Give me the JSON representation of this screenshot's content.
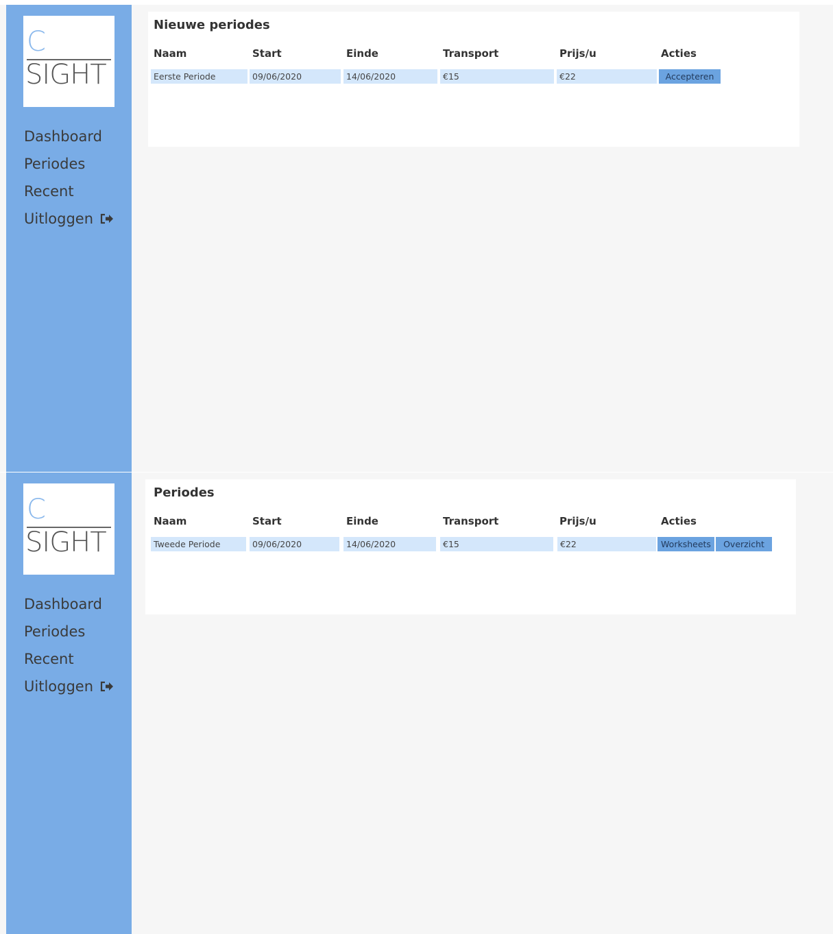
{
  "sidebar": {
    "logo": {
      "letter": "C",
      "word": "SIGHT"
    },
    "nav": [
      "Dashboard",
      "Periodes",
      "Recent",
      "Uitloggen"
    ]
  },
  "screens": [
    {
      "title": "Nieuwe periodes",
      "columns": [
        "Naam",
        "Start",
        "Einde",
        "Transport",
        "Prijs/u",
        "Acties"
      ],
      "row": {
        "naam": "Eerste Periode",
        "start": "09/06/2020",
        "einde": "14/06/2020",
        "transport": "€15",
        "prijs": "€22"
      },
      "actions": [
        "Accepteren"
      ]
    },
    {
      "title": "Periodes",
      "columns": [
        "Naam",
        "Start",
        "Einde",
        "Transport",
        "Prijs/u",
        "Acties"
      ],
      "row": {
        "naam": "Tweede Periode",
        "start": "09/06/2020",
        "einde": "14/06/2020",
        "transport": "€15",
        "prijs": "€22"
      },
      "actions": [
        "Worksheets",
        "Overzicht"
      ]
    }
  ],
  "colors": {
    "sidebar": "#79ace6",
    "cell": "#d4e7fb",
    "button": "#6ba3e0",
    "background": "#f6f6f6"
  },
  "icons": {
    "logout": "sign-out-icon"
  }
}
